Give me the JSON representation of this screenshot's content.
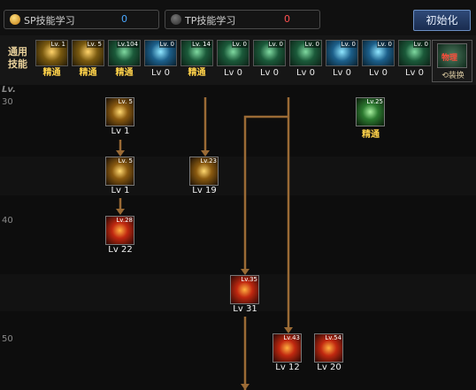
{
  "tabs": [
    {
      "label": "SP技能学习",
      "value": "0",
      "dot_color": "#e8a020",
      "value_color": "#4aa8ff"
    },
    {
      "label": "TP技能学习",
      "value": "0",
      "dot_color": "#4a4a4a",
      "value_color": "#ff5050"
    }
  ],
  "reset_button": "初始化",
  "common": {
    "label": "通用技能",
    "skills": [
      {
        "lv": "Lv. 1",
        "tag": "精通",
        "style": "gold",
        "master": true
      },
      {
        "lv": "Lv. 5",
        "tag": "精通",
        "style": "gold",
        "master": true
      },
      {
        "lv": "Lv.104",
        "tag": "精通",
        "style": "green",
        "master": true
      },
      {
        "lv": "Lv. 0",
        "tag": "Lv 0",
        "style": "blue",
        "master": false
      },
      {
        "lv": "Lv. 14",
        "tag": "精通",
        "style": "green",
        "master": true
      },
      {
        "lv": "Lv. 0",
        "tag": "Lv 0",
        "style": "green",
        "master": false
      },
      {
        "lv": "Lv. 0",
        "tag": "Lv 0",
        "style": "green",
        "master": false
      },
      {
        "lv": "Lv. 0",
        "tag": "Lv 0",
        "style": "green",
        "master": false
      },
      {
        "lv": "Lv. 0",
        "tag": "Lv 0",
        "style": "blue",
        "master": false
      },
      {
        "lv": "Lv. 0",
        "tag": "Lv 0",
        "style": "blue",
        "master": false
      },
      {
        "lv": "Lv. 0",
        "tag": "Lv 0",
        "style": "green",
        "master": false
      }
    ],
    "swap": {
      "icon_text": "物理",
      "label": "⟲装换"
    }
  },
  "level_header": "Lv.",
  "levels": [
    "30",
    "40",
    "50"
  ],
  "tree": [
    {
      "lv": "Lv. 5",
      "cap": "Lv 1",
      "style": "y",
      "master": false
    },
    {
      "lv": "Lv.25",
      "cap": "精通",
      "style": "g",
      "master": true
    },
    {
      "lv": "Lv. 5",
      "cap": "Lv 1",
      "style": "y",
      "master": false
    },
    {
      "lv": "Lv.23",
      "cap": "Lv 19",
      "style": "y",
      "master": false
    },
    {
      "lv": "Lv.28",
      "cap": "Lv 22",
      "style": "r",
      "master": false
    },
    {
      "lv": "Lv.35",
      "cap": "Lv 31",
      "style": "r",
      "master": false
    },
    {
      "lv": "Lv.43",
      "cap": "Lv 12",
      "style": "r",
      "master": false
    },
    {
      "lv": "Lv.54",
      "cap": "Lv 20",
      "style": "r",
      "master": false
    }
  ],
  "colors": {
    "arrow": "#9a6a35",
    "gold": "#ffd24a"
  }
}
